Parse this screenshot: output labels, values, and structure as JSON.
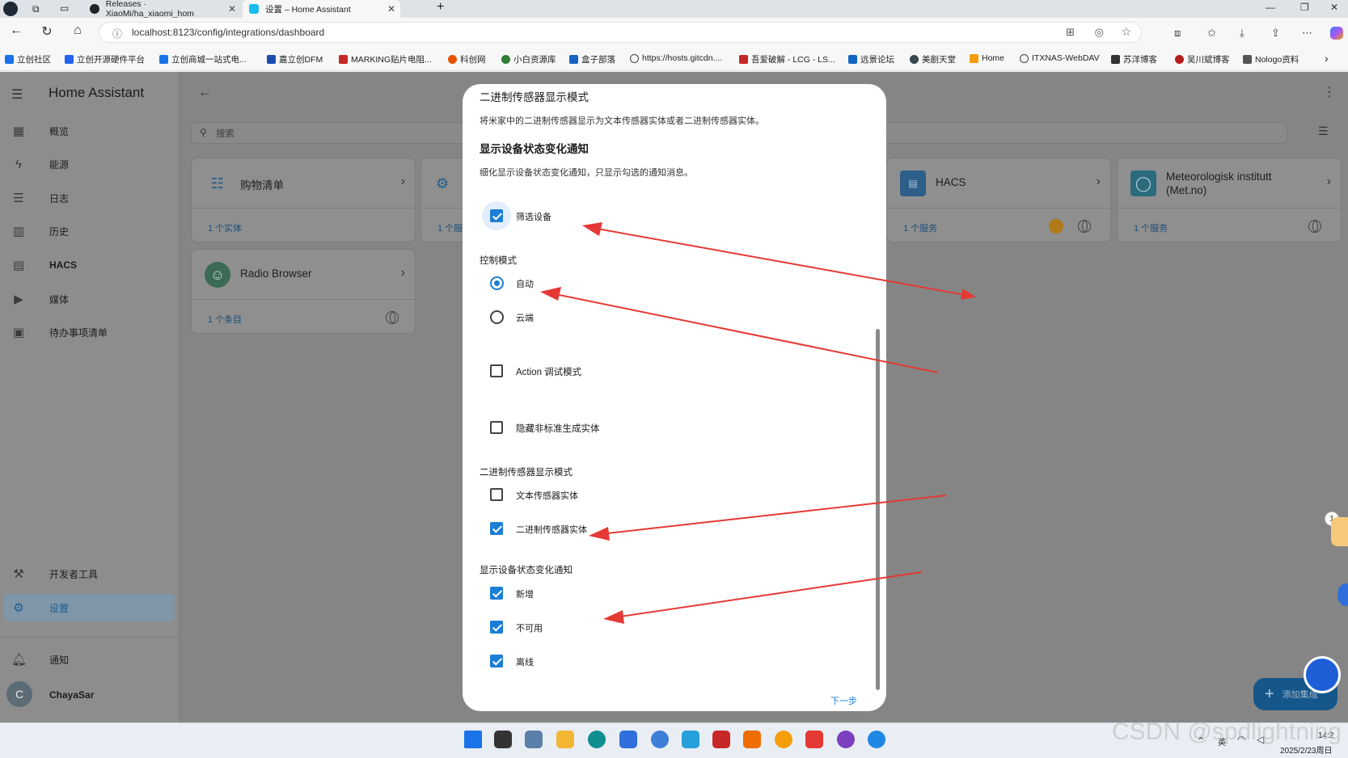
{
  "browser": {
    "tabs": [
      {
        "label": "Releases · XiaoMi/ha_xiaomi_hom",
        "close": "✕"
      },
      {
        "label": "设置 – Home Assistant",
        "close": "✕"
      }
    ],
    "new_tab": "+",
    "url": "localhost:8123/config/integrations/dashboard",
    "window_controls": {
      "minimize": "—",
      "restore": "❐",
      "close": "✕"
    },
    "bookmarks": [
      "立创社区",
      "立创开源硬件平台",
      "立创商城一站式电...",
      "嘉立创DFM",
      "MARKING贴片电阻...",
      "科创网",
      "小白资源库",
      "盒子部落",
      "https://hosts.gitcdn....",
      "吾爱破解 - LCG - LS...",
      "远景论坛",
      "美剧天堂",
      "Home",
      "ITXNAS-WebDAV",
      "苏洋博客",
      "吴川斌博客",
      "Nologo资料"
    ],
    "bookmarks_more": "›"
  },
  "sidebar": {
    "title": "Home Assistant",
    "items": [
      {
        "label": "概览",
        "icon": "dashboard-icon"
      },
      {
        "label": "能源",
        "icon": "lightning-icon"
      },
      {
        "label": "日志",
        "icon": "list-icon"
      },
      {
        "label": "历史",
        "icon": "chart-icon"
      },
      {
        "label": "HACS",
        "icon": "hacs-icon"
      },
      {
        "label": "媒体",
        "icon": "media-icon"
      },
      {
        "label": "待办事项清单",
        "icon": "clipboard-icon"
      }
    ],
    "bottom_items": [
      {
        "label": "开发者工具",
        "icon": "hammer-icon"
      },
      {
        "label": "设置",
        "icon": "gear-icon",
        "selected": true
      }
    ],
    "notifications": "通知",
    "user": {
      "initial": "C",
      "name": "ChayaSar"
    }
  },
  "main": {
    "search_placeholder": "搜索",
    "cards": [
      {
        "title": "购物清单",
        "link": "1 个实体"
      },
      {
        "title": "",
        "link": "1 个服"
      },
      {
        "title": "HACS",
        "link": "1 个服务"
      },
      {
        "title": "Meteorologisk institutt (Met.no)",
        "link": "1 个服务"
      },
      {
        "title": "Radio Browser",
        "link": "1 个条目"
      }
    ],
    "fab_label": "添加集成",
    "fab_plus": "+"
  },
  "dialog": {
    "heading_top": "二进制传感器显示模式",
    "desc_top": "将米家中的二进制传感器显示为文本传感器实体或者二进制传感器实体。",
    "heading_notify": "显示设备状态变化通知",
    "desc_notify": "细化显示设备状态变化通知，只显示勾选的通知消息。",
    "filter_devices": {
      "label": "筛选设备",
      "checked": true
    },
    "control_mode": {
      "label": "控制模式",
      "options": [
        {
          "label": "自动",
          "selected": true
        },
        {
          "label": "云端",
          "selected": false
        }
      ]
    },
    "action_debug": {
      "label": "Action 调试模式",
      "checked": false
    },
    "hide_nonstandard": {
      "label": "隐藏非标准生成实体",
      "checked": false
    },
    "binary_mode": {
      "label": "二进制传感器显示模式",
      "options": [
        {
          "label": "文本传感器实体",
          "checked": false
        },
        {
          "label": "二进制传感器实体",
          "checked": true
        }
      ]
    },
    "notify_section": {
      "label": "显示设备状态变化通知",
      "options": [
        {
          "label": "新增",
          "checked": true
        },
        {
          "label": "不可用",
          "checked": true
        },
        {
          "label": "离线",
          "checked": true
        }
      ]
    },
    "next_label": "下一步"
  },
  "taskbar": {
    "tray": {
      "ime": "英",
      "time": "14:2",
      "date": "2025/2/23周日"
    },
    "badge": "1"
  },
  "watermark": "CSDN @spdlightning",
  "colors": {
    "accent": "#1c7fd6",
    "annotation_arrow": "#e53935",
    "overlay": "#858585"
  }
}
